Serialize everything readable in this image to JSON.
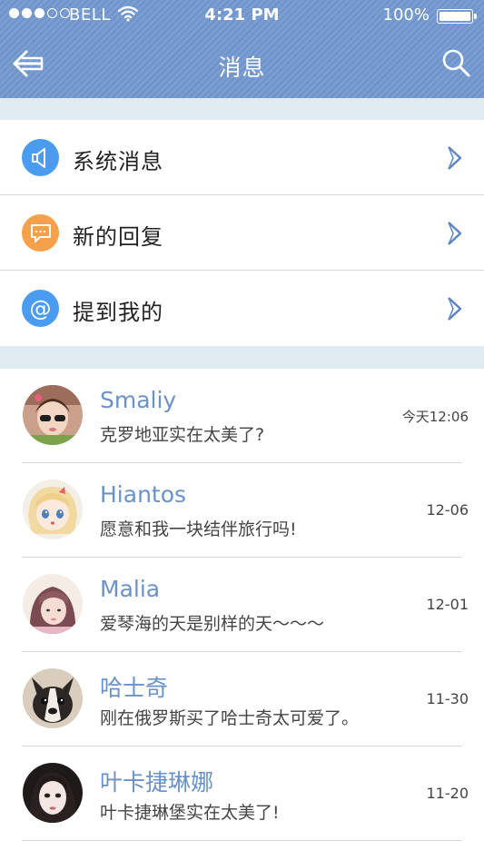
{
  "status_bar": {
    "carrier": "BELL",
    "time": "4:21 PM",
    "battery": "100%",
    "battery_level": 1.0,
    "signal_bars_filled": 3,
    "signal_bars_total": 5
  },
  "nav": {
    "title": "消息",
    "back_icon": "back-arrow-icon",
    "search_icon": "search-icon"
  },
  "colors": {
    "header": "#6f95cc",
    "accent_blue": "#4a9cf0",
    "accent_orange": "#f5a04a",
    "name_blue": "#6a92c8",
    "section_gap": "#e1ecf2"
  },
  "menu": [
    {
      "label": "系统消息",
      "icon": "speaker-icon",
      "icon_color": "#4a9cf0"
    },
    {
      "label": "新的回复",
      "icon": "chat-bubble-icon",
      "icon_color": "#f5a04a"
    },
    {
      "label": "提到我的",
      "icon": "at-icon",
      "icon_color": "#4a9cf0",
      "glyph": "@"
    }
  ],
  "chats": [
    {
      "name": "Smaliy",
      "message": "克罗地亚实在太美了?",
      "time": "今天12:06"
    },
    {
      "name": "Hiantos",
      "message": "愿意和我一块结伴旅行吗!",
      "time": "12-06"
    },
    {
      "name": "Malia",
      "message": "爱琴海的天是别样的天～～～",
      "time": "12-01"
    },
    {
      "name": "哈士奇",
      "message": "刚在俄罗斯买了哈士奇太可爱了。",
      "time": "11-30"
    },
    {
      "name": "叶卡捷琳娜",
      "message": "叶卡捷琳堡实在太美了!",
      "time": "11-20"
    }
  ]
}
